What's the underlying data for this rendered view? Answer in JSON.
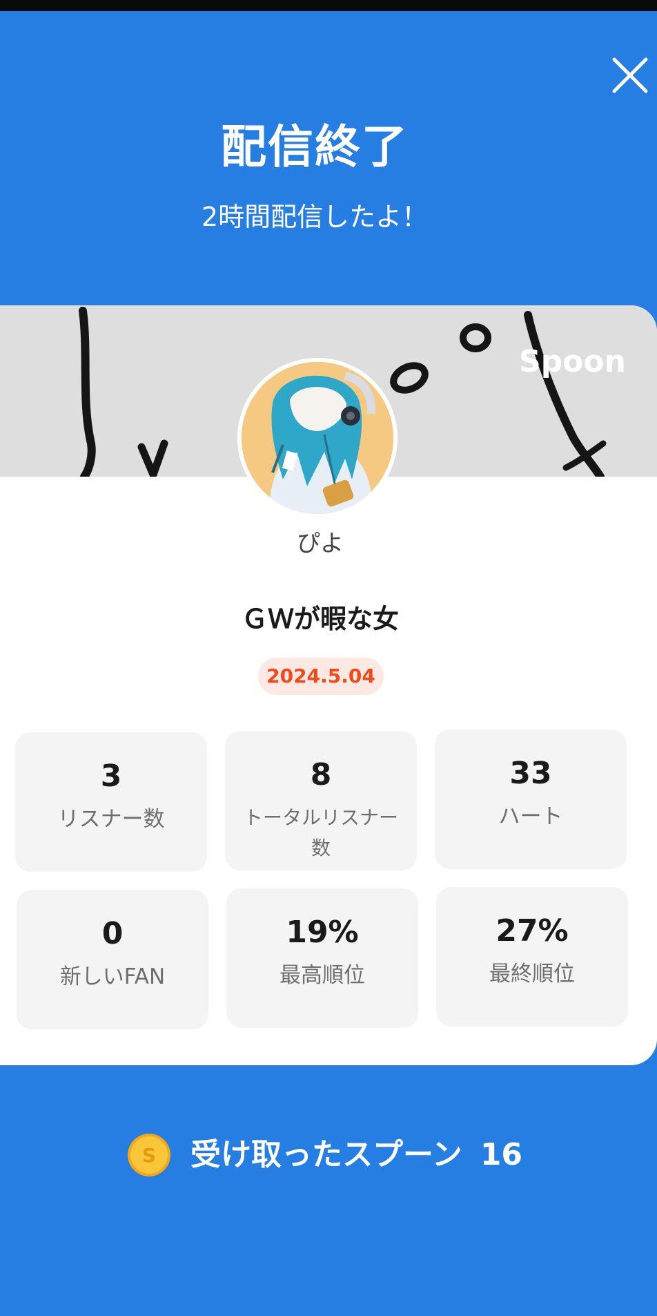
{
  "header": {
    "title": "配信終了",
    "subtitle": "2時間配信したよ！",
    "close_icon": "close-icon"
  },
  "profile": {
    "brand_logo": "Spoon",
    "username": "ぴよ",
    "avatar_icon": "avatar-illustration"
  },
  "broadcast": {
    "title": "ＧＷが暇な女",
    "date": "2024.5.04"
  },
  "stats": [
    {
      "value": "3",
      "label": "リスナー数"
    },
    {
      "value": "8",
      "label": "トータルリスナー数"
    },
    {
      "value": "33",
      "label": "ハート"
    },
    {
      "value": "0",
      "label": "新しいFAN"
    },
    {
      "value": "19%",
      "label": "最高順位"
    },
    {
      "value": "27%",
      "label": "最終順位"
    }
  ],
  "spoons": {
    "label": "受け取ったスプーン",
    "count": "16",
    "coin_icon": "spoon-coin-icon",
    "coin_letter": "S"
  },
  "colors": {
    "background": "#267ee3",
    "date_text": "#f2491b",
    "date_badge": "#fde9e3",
    "coin": "#f6b51e"
  }
}
